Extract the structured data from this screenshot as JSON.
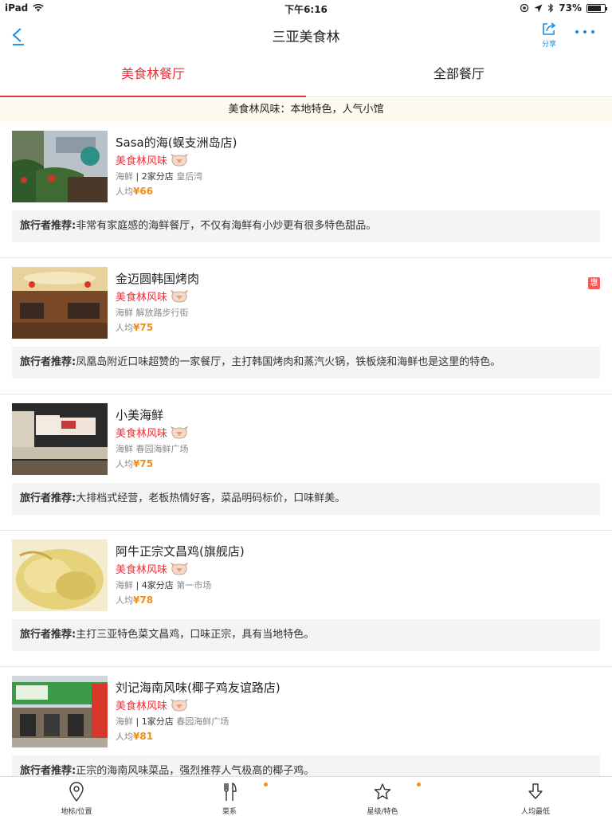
{
  "status": {
    "device": "iPad",
    "time": "下午6:16",
    "battery": "73%"
  },
  "nav": {
    "title": "三亚美食林",
    "share_label": "分享"
  },
  "tabs": {
    "active": "美食林餐厅",
    "other": "全部餐厅"
  },
  "banner": "美食林风味：本地特色，人气小馆",
  "recommend_label": "旅行者推荐:",
  "restaurants": [
    {
      "name": "Sasa的海(蜈支洲岛店)",
      "tag": "美食林风味",
      "cuisine": "海鲜",
      "branches": "2家分店",
      "area": "皇后湾",
      "price_label": "人均",
      "price": "¥66",
      "recommend": "非常有家庭感的海鲜餐厅，不仅有海鲜有小炒更有很多特色甜品。",
      "hui": ""
    },
    {
      "name": "金迈圆韩国烤肉",
      "tag": "美食林风味",
      "cuisine": "海鲜",
      "branches": "",
      "area": "解放路步行街",
      "price_label": "人均",
      "price": "¥75",
      "recommend": "凤凰岛附近口味超赞的一家餐厅，主打韩国烤肉和蒸汽火锅，铁板烧和海鲜也是这里的特色。",
      "hui": "惠"
    },
    {
      "name": "小美海鲜",
      "tag": "美食林风味",
      "cuisine": "海鲜",
      "branches": "",
      "area": "春园海鲜广场",
      "price_label": "人均",
      "price": "¥75",
      "recommend": "大排档式经营，老板热情好客，菜品明码标价，口味鲜美。",
      "hui": ""
    },
    {
      "name": "阿牛正宗文昌鸡(旗舰店)",
      "tag": "美食林风味",
      "cuisine": "海鲜",
      "branches": "4家分店",
      "area": "第一市场",
      "price_label": "人均",
      "price": "¥78",
      "recommend": "主打三亚特色菜文昌鸡，口味正宗，具有当地特色。",
      "hui": ""
    },
    {
      "name": "刘记海南风味(椰子鸡友谊路店)",
      "tag": "美食林风味",
      "cuisine": "海鲜",
      "branches": "1家分店",
      "area": "春园海鲜广场",
      "price_label": "人均",
      "price": "¥81",
      "recommend": "正宗的海南风味菜品，强烈推荐人气极高的椰子鸡。",
      "hui": ""
    }
  ],
  "tabbar": [
    {
      "label": "地标/位置",
      "icon": "location-pin-icon"
    },
    {
      "label": "菜系",
      "icon": "fork-knife-icon"
    },
    {
      "label": "星级/特色",
      "icon": "star-icon"
    },
    {
      "label": "人均最低",
      "icon": "arrow-down-icon"
    }
  ],
  "colors": {
    "accent": "#e8323c",
    "link": "#1a8be6",
    "price": "#f08c1a"
  }
}
